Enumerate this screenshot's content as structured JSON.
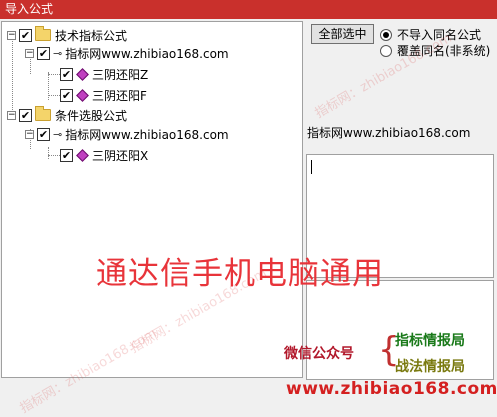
{
  "window": {
    "title": "导入公式"
  },
  "tree": {
    "group1": {
      "label": "技术指标公式",
      "source": "指标网www.zhibiao168.com",
      "items": [
        "三阴还阳Z",
        "三阴还阳F"
      ]
    },
    "group2": {
      "label": "条件选股公式",
      "source": "指标网www.zhibiao168.com",
      "items": [
        "三阴还阳X"
      ]
    }
  },
  "actions": {
    "select_all": "全部选中",
    "radio_skip": "不导入同名公式",
    "radio_overwrite": "覆盖同名(非系统)",
    "selected_radio": "skip"
  },
  "info": {
    "name": "指标网www.zhibiao168.com"
  },
  "watermark": {
    "big": "通达信手机电脑通用",
    "wechat": "微信公众号",
    "tag1": "指标情报局",
    "tag2": "战法情报局",
    "site": "www.zhibiao168.com",
    "faint": "指标网：zhibiao168.com"
  },
  "colors": {
    "titlebar": "#c9302c",
    "overlay": "#e8343a"
  }
}
